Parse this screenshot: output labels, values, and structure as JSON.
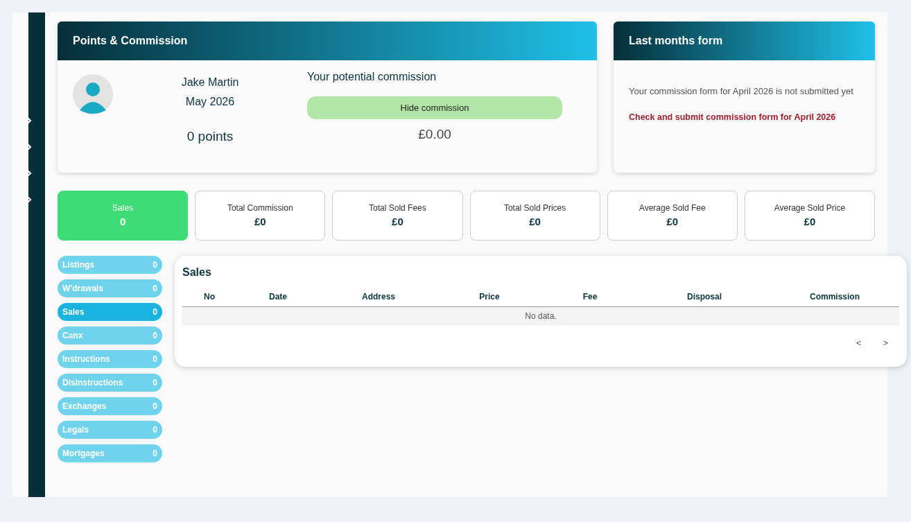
{
  "points_card": {
    "title": "Points & Commission",
    "user_name": "Jake Martin",
    "period": "May 2026",
    "points": "0 points",
    "commission_heading": "Your potential commission",
    "toggle_button": "Hide commission",
    "commission_amount": "£0.00"
  },
  "form_card": {
    "title": "Last months form",
    "message": "Your commission form for April 2026 is not submitted yet",
    "link": "Check and submit commission form for April 2026"
  },
  "stats": [
    {
      "label": "Sales",
      "value": "0",
      "selected": true
    },
    {
      "label": "Total Commission",
      "value": "£0",
      "selected": false
    },
    {
      "label": "Total Sold Fees",
      "value": "£0",
      "selected": false
    },
    {
      "label": "Total Sold Prices",
      "value": "£0",
      "selected": false
    },
    {
      "label": "Average Sold Fee",
      "value": "£0",
      "selected": false
    },
    {
      "label": "Average Sold Price",
      "value": "£0",
      "selected": false
    }
  ],
  "categories": [
    {
      "label": "Listings",
      "count": "0",
      "selected": false
    },
    {
      "label": "W'drawals",
      "count": "0",
      "selected": false
    },
    {
      "label": "Sales",
      "count": "0",
      "selected": true
    },
    {
      "label": "Canx",
      "count": "0",
      "selected": false
    },
    {
      "label": "Instructions",
      "count": "0",
      "selected": false
    },
    {
      "label": "Disinstructions",
      "count": "0",
      "selected": false
    },
    {
      "label": "Exchanges",
      "count": "0",
      "selected": false
    },
    {
      "label": "Legals",
      "count": "0",
      "selected": false
    },
    {
      "label": "Mortgages",
      "count": "0",
      "selected": false
    }
  ],
  "table": {
    "title": "Sales",
    "columns": [
      "No",
      "Date",
      "Address",
      "Price",
      "Fee",
      "Disposal",
      "Commission"
    ],
    "empty_text": "No data.",
    "pager": [
      "<",
      ">"
    ]
  }
}
